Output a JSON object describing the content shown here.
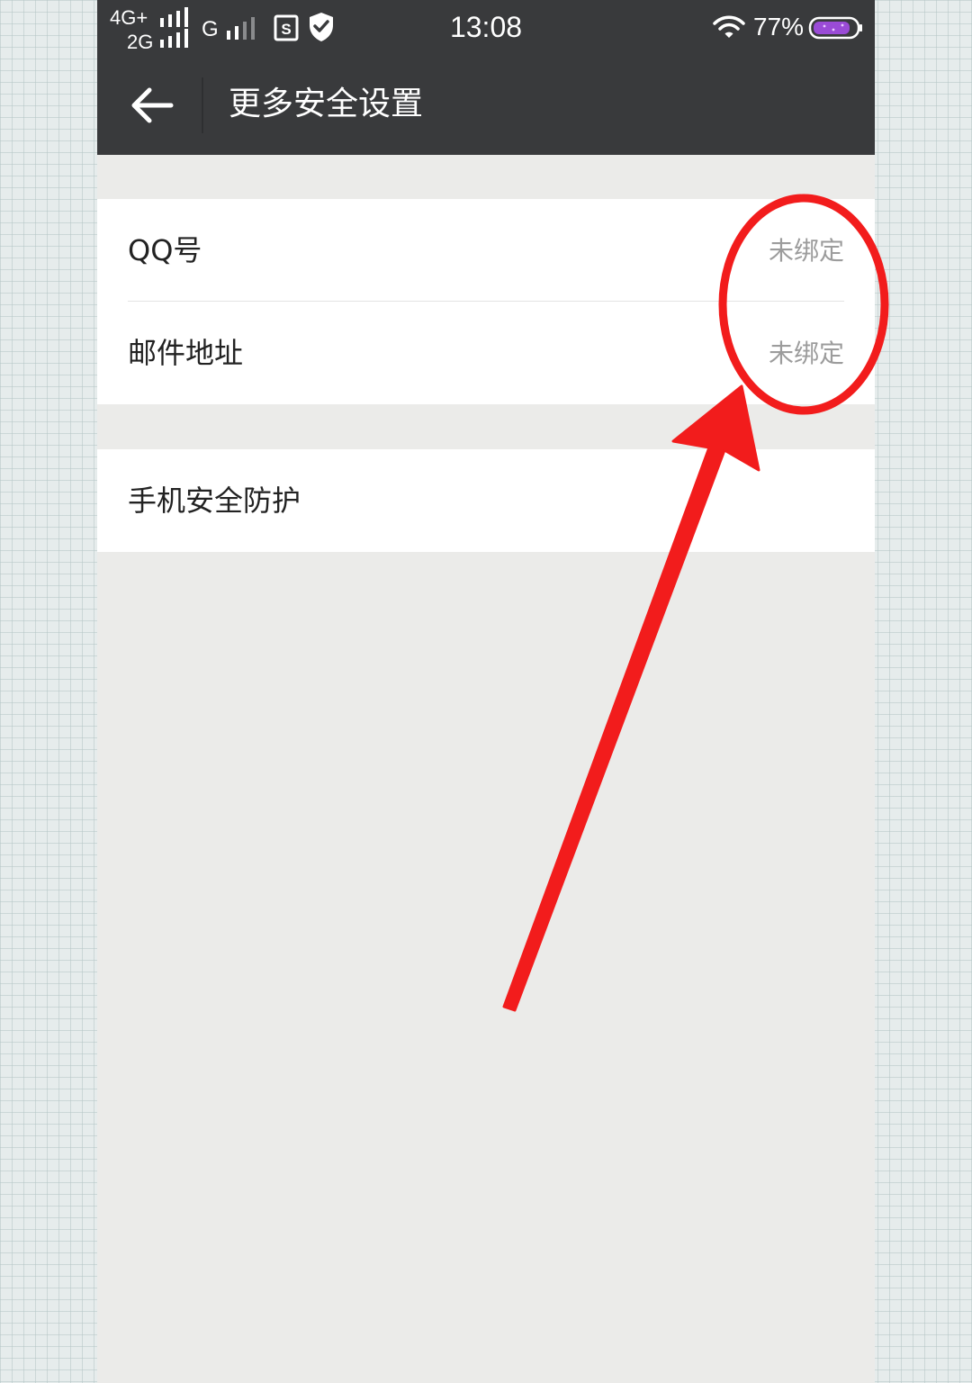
{
  "status_bar": {
    "network_1": "4G+",
    "network_2": "2G",
    "network_3": "G",
    "time": "13:08",
    "battery": "77%",
    "icons": [
      "signal-icon",
      "sim-s-icon",
      "shield-check-icon",
      "wifi-icon",
      "battery-icon"
    ]
  },
  "app_bar": {
    "title": "更多安全设置",
    "back_icon": "arrow-left-icon"
  },
  "groups": [
    {
      "items": [
        {
          "label": "QQ号",
          "value": "未绑定"
        },
        {
          "label": "邮件地址",
          "value": "未绑定"
        }
      ]
    },
    {
      "items": [
        {
          "label": "手机安全防护"
        }
      ]
    }
  ],
  "colors": {
    "app_bar_bg": "#393a3c",
    "page_bg": "#ebebe9",
    "annotation_red": "#f21c1c",
    "value_gray": "#9c9c9c",
    "battery_purple": "#9a4bd6"
  }
}
